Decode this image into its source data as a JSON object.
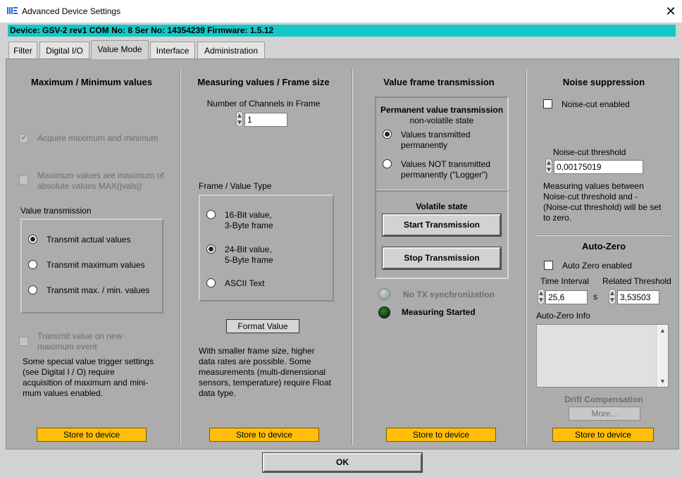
{
  "window": {
    "title": "Advanced Device Settings",
    "close_glyph": "✕"
  },
  "device_bar": {
    "text": "Device: GSV-2 rev1 COM No: 8 Ser No: 14354239 Firmware: 1.5.12",
    "color": "#14c8c8"
  },
  "tabs": [
    {
      "label": "Filter",
      "active": false
    },
    {
      "label": "Digital I/O",
      "active": false
    },
    {
      "label": "Value Mode",
      "active": true
    },
    {
      "label": "Interface",
      "active": false
    },
    {
      "label": "Administration",
      "active": false
    }
  ],
  "minmax": {
    "title": "Maximum / Minimum values",
    "acquire_label": "Acquire maximum and minimum",
    "acquire_checked": true,
    "absolute_label": "Maximum values are maximum of absolute values MAX(|vals|)",
    "absolute_checked": false,
    "transmission_title": "Value transmission",
    "options": [
      {
        "label": "Transmit actual values",
        "selected": true
      },
      {
        "label": "Transmit maximum values",
        "selected": false
      },
      {
        "label": "Transmit max. / min. values",
        "selected": false
      }
    ],
    "new_max_label": "Transmit value on new maximum event",
    "new_max_checked": false,
    "note": "Some special value trigger settings (see Digital I / O) require acquisition of maximum and mini-mum values enabled.",
    "store_label": "Store to device"
  },
  "measuring": {
    "title": "Measuring values / Frame size",
    "channels_label": "Number of Channels in Frame",
    "channels_value": "1",
    "frame_type_title": "Frame / Value Type",
    "options": [
      {
        "line1": "16-Bit value,",
        "line2": "3-Byte frame",
        "selected": false
      },
      {
        "line1": "24-Bit value,",
        "line2": "5-Byte frame",
        "selected": true
      },
      {
        "line1": "ASCII Text",
        "line2": "",
        "selected": false
      }
    ],
    "format_button": "Format Value",
    "note": "With smaller frame size, higher data rates are possible. Some measurements (multi-dimensional sensors, temperature) require Float data type.",
    "store_label": "Store to device"
  },
  "transmission": {
    "title": "Value frame transmission",
    "permanent_title": "Permanent value transmission",
    "permanent_subtitle": "non-volatile state",
    "options": [
      {
        "label": "Values transmitted permanently",
        "selected": true
      },
      {
        "label": "Values NOT transmitted permanently (\"Logger\")",
        "selected": false
      }
    ],
    "volatile_title": "Volatile state",
    "start_button": "Start Transmission",
    "stop_button": "Stop Transmission",
    "no_tx_label": "No TX synchronization",
    "no_tx_led_color": "#9aa89a",
    "measuring_label": "Measuring Started",
    "measuring_led_color": "#0f3a0f",
    "store_label": "Store to device"
  },
  "noise": {
    "title": "Noise suppression",
    "noise_cut_label": "Noise-cut enabled",
    "noise_cut_checked": false,
    "threshold_label": "Noise-cut threshold",
    "threshold_value": "0,00175019",
    "note": "Measuring values between Noise-cut threshold and -(Noise-cut threshold) will be set to zero.",
    "autozero_title": "Auto-Zero",
    "autozero_label": "Auto Zero enabled",
    "autozero_checked": false,
    "interval_label": "Time Interval",
    "interval_value": "25,6",
    "interval_unit": "s",
    "related_label": "Related Threshold",
    "related_value": "3,53503",
    "info_label": "Auto-Zero Info",
    "info_text": "",
    "drift_title": "Drift Compensation",
    "more_button": "More...",
    "store_label": "Store to device"
  },
  "footer": {
    "ok_label": "OK"
  }
}
